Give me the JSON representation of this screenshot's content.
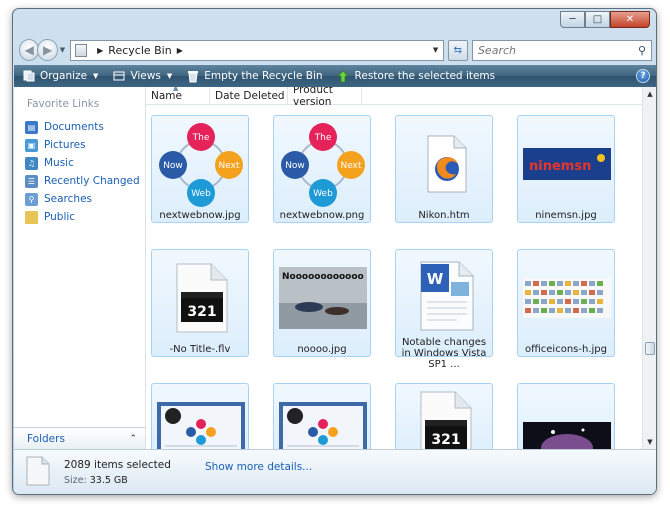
{
  "address": {
    "location": "Recycle Bin"
  },
  "search": {
    "placeholder": "Search"
  },
  "toolbar": {
    "organize": "Organize",
    "views": "Views",
    "empty": "Empty the Recycle Bin",
    "restore": "Restore the selected items"
  },
  "sidebar": {
    "title": "Favorite Links",
    "links": [
      "Documents",
      "Pictures",
      "Music",
      "Recently Changed",
      "Searches",
      "Public"
    ],
    "folders": "Folders"
  },
  "columns": [
    "Name",
    "Date Deleted",
    "Product version"
  ],
  "files": [
    {
      "name": "nextwebnow.jpg"
    },
    {
      "name": "nextwebnow.png"
    },
    {
      "name": "Nikon.htm"
    },
    {
      "name": "ninemsn.jpg"
    },
    {
      "name": "-No Title-.flv"
    },
    {
      "name": "noooo.jpg"
    },
    {
      "name": "Notable changes in Windows Vista SP1 ..."
    },
    {
      "name": "officeicons-h.jpg"
    }
  ],
  "thumbs": {
    "cycle": [
      "The",
      "Next",
      "Web",
      "Now"
    ],
    "ninemsn": "ninemsn",
    "clapper": "321",
    "noooo": "Noooooooooooo"
  },
  "details": {
    "selected": "2089 items selected",
    "size_label": "Size:",
    "size_value": "33.5 GB",
    "more": "Show more details..."
  },
  "colors": {
    "toolbar": "#3e6580",
    "link": "#1a5fb4",
    "tile_border": "#a9d2f2"
  }
}
